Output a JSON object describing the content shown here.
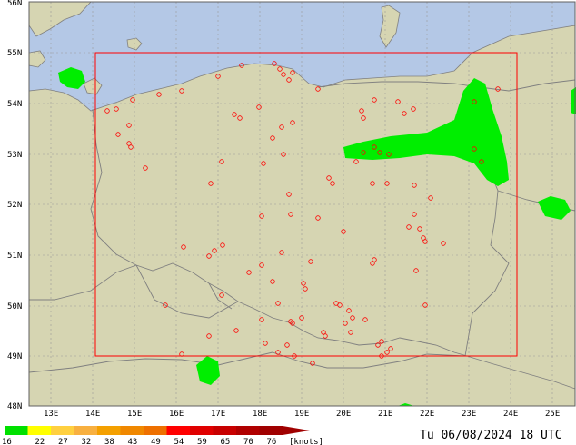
{
  "map": {
    "title_stamp": "Tu 06/08/2024 18 UTC",
    "lat_labels": [
      "56N",
      "55N",
      "54N",
      "53N",
      "52N",
      "51N",
      "50N",
      "49N",
      "48N"
    ],
    "lon_labels": [
      "13E",
      "14E",
      "15E",
      "16E",
      "17E",
      "18E",
      "19E",
      "20E",
      "21E",
      "22E",
      "23E",
      "24E",
      "25E"
    ],
    "colors": {
      "sea": "#b4c8e6",
      "land": "#d6d5b2",
      "border": "#808080",
      "grid": "#9a9a9a",
      "domain_box": "#ff0000",
      "station": "#ff0000",
      "gust_zone": "#00ee00"
    }
  },
  "legend": {
    "units_label": "[knots]",
    "items": [
      {
        "label": "16",
        "color": "#00e000"
      },
      {
        "label": "22",
        "color": "#ffff00"
      },
      {
        "label": "27",
        "color": "#ffd040"
      },
      {
        "label": "32",
        "color": "#f8b040"
      },
      {
        "label": "38",
        "color": "#f4a000"
      },
      {
        "label": "43",
        "color": "#f08800"
      },
      {
        "label": "49",
        "color": "#ee7000"
      },
      {
        "label": "54",
        "color": "#ff0000"
      },
      {
        "label": "59",
        "color": "#e00000"
      },
      {
        "label": "65",
        "color": "#c80000"
      },
      {
        "label": "70",
        "color": "#b00000"
      },
      {
        "label": "76",
        "color": "#a00000"
      }
    ]
  }
}
